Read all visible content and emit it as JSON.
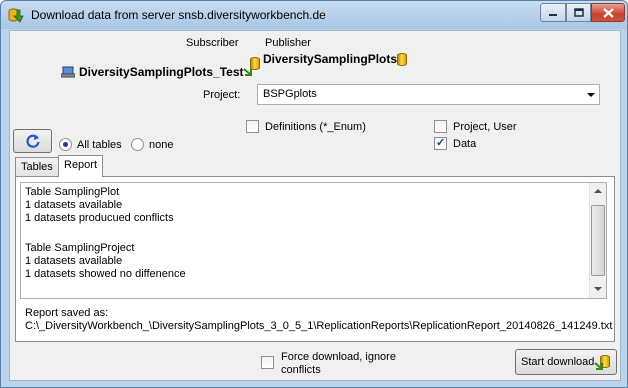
{
  "window": {
    "title": "Download data from server snsb.diversityworkbench.de",
    "icon": "download-window-icon",
    "controls": [
      "minimize-icon",
      "maximize-icon",
      "close-icon"
    ]
  },
  "header": {
    "subscriber_label": "Subscriber",
    "publisher_label": "Publisher",
    "subscriber_db": "DiversitySamplingPlots_Test",
    "publisher_db": "DiversitySamplingPlots"
  },
  "project": {
    "label": "Project:",
    "value": "BSPGplots"
  },
  "options": {
    "definitions": {
      "label": "Definitions (*_Enum)",
      "checked": false
    },
    "project_user": {
      "label": "Project, User",
      "checked": false
    },
    "data": {
      "label": "Data",
      "checked": true
    },
    "all_tables": {
      "label": "All tables",
      "selected": true
    },
    "none": {
      "label": "none",
      "selected": false
    }
  },
  "tabs": [
    {
      "label": "Tables",
      "active": false
    },
    {
      "label": "Report",
      "active": true
    }
  ],
  "report": {
    "lines": [
      "Table SamplingPlot",
      "1 datasets available",
      "1 datasets producued conflicts",
      "",
      "Table SamplingProject",
      "1 datasets available",
      "1 datasets showed no diffenence"
    ],
    "saved_label": "Report saved as:",
    "saved_path": "C:\\_DiversityWorkbench_\\DiversitySamplingPlots_3_0_5_1\\ReplicationReports\\ReplicationReport_20140826_141249.txt"
  },
  "footer": {
    "force_download_line1": "Force download, ignore",
    "force_download_line2": "conflicts",
    "force_download_checked": false,
    "start_button": "Start download"
  }
}
